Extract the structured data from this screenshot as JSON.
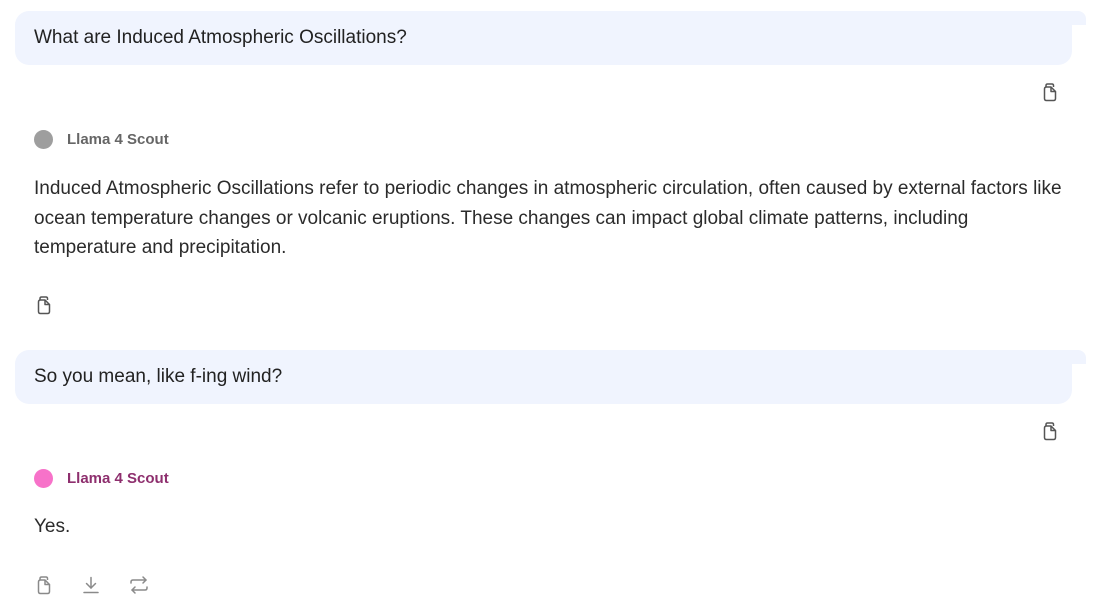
{
  "conversation": {
    "messages": [
      {
        "role": "user",
        "text": "What are Induced Atmospheric Oscillations?"
      },
      {
        "role": "assistant",
        "model_name": "Llama 4 Scout",
        "avatar_color": "#9e9e9e",
        "name_color": "#666666",
        "text": "Induced Atmospheric Oscillations refer to periodic changes in atmospheric circulation, often caused by external factors like ocean temperature changes or volcanic eruptions. These changes can impact global climate patterns, including temperature and precipitation."
      },
      {
        "role": "user",
        "text": "So you mean, like f-ing wind?"
      },
      {
        "role": "assistant",
        "model_name": "Llama 4 Scout",
        "avatar_color": "#f772c9",
        "name_color": "#8e2f6e",
        "text": "Yes."
      }
    ]
  },
  "icons": {
    "copy": "copy-icon",
    "download": "download-icon",
    "regenerate": "regenerate-icon"
  },
  "colors": {
    "user_bubble": "#f0f4fe",
    "icon": "#555555"
  }
}
